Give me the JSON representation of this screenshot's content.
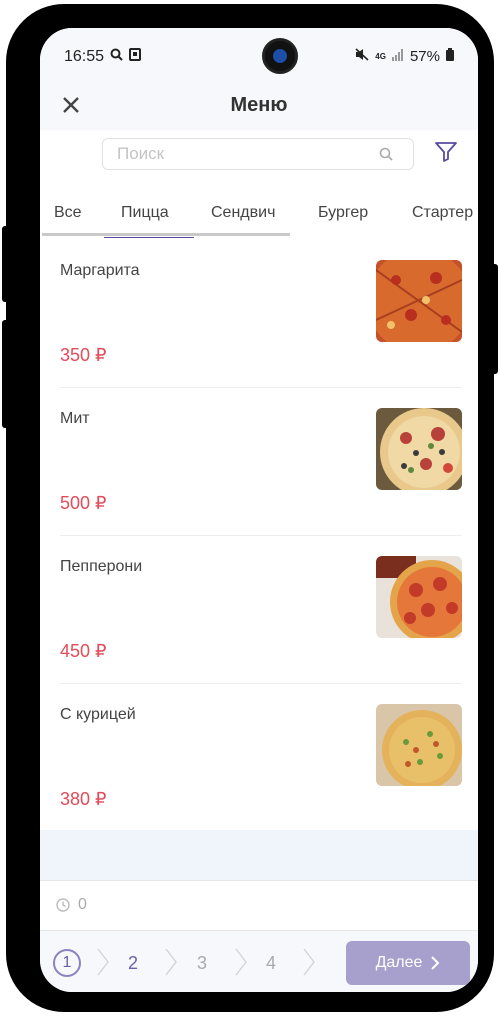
{
  "status_bar": {
    "time": "16:55",
    "network": "4G",
    "battery": "57%"
  },
  "app_bar": {
    "title": "Меню"
  },
  "search": {
    "placeholder": "Поиск"
  },
  "tabs": [
    {
      "label": "Все"
    },
    {
      "label": "Пицца",
      "active": true
    },
    {
      "label": "Сендвич"
    },
    {
      "label": "Бургер"
    },
    {
      "label": "Стартер"
    }
  ],
  "items": [
    {
      "name": "Маргарита",
      "price": "350 ₽"
    },
    {
      "name": "Мит",
      "price": "500 ₽"
    },
    {
      "name": "Пепперони",
      "price": "450 ₽"
    },
    {
      "name": "С курицей",
      "price": "380 ₽"
    }
  ],
  "timer": {
    "value": "0"
  },
  "stepper": {
    "steps": [
      "1",
      "2",
      "3",
      "4"
    ],
    "current": 1
  },
  "next_button": {
    "label": "Далее"
  },
  "colors": {
    "accent": "#5b4aa0",
    "price": "#e34b5a",
    "next_button_bg": "#a79fcc"
  }
}
